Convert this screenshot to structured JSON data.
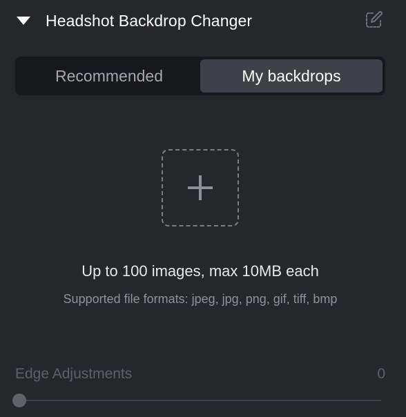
{
  "panel": {
    "title": "Headshot Backdrop Changer",
    "collapse_icon": "triangle-down-icon",
    "edit_icon": "edit-icon"
  },
  "tabs": {
    "items": [
      {
        "label": "Recommended",
        "selected": false
      },
      {
        "label": "My backdrops",
        "selected": true
      }
    ]
  },
  "upload": {
    "icon": "plus-icon",
    "main_text": "Up to 100 images, max 10MB each",
    "sub_text": "Supported file formats: jpeg, jpg, png, gif, tiff, bmp"
  },
  "edge_adjustments": {
    "label": "Edge Adjustments",
    "value": "0",
    "slider_level": 0
  },
  "colors": {
    "background": "#25272b",
    "segmented_bg": "#17181b",
    "selected_tab_bg": "#3e4148",
    "muted_text": "#8f9298",
    "disabled_text": "#5d6066"
  }
}
